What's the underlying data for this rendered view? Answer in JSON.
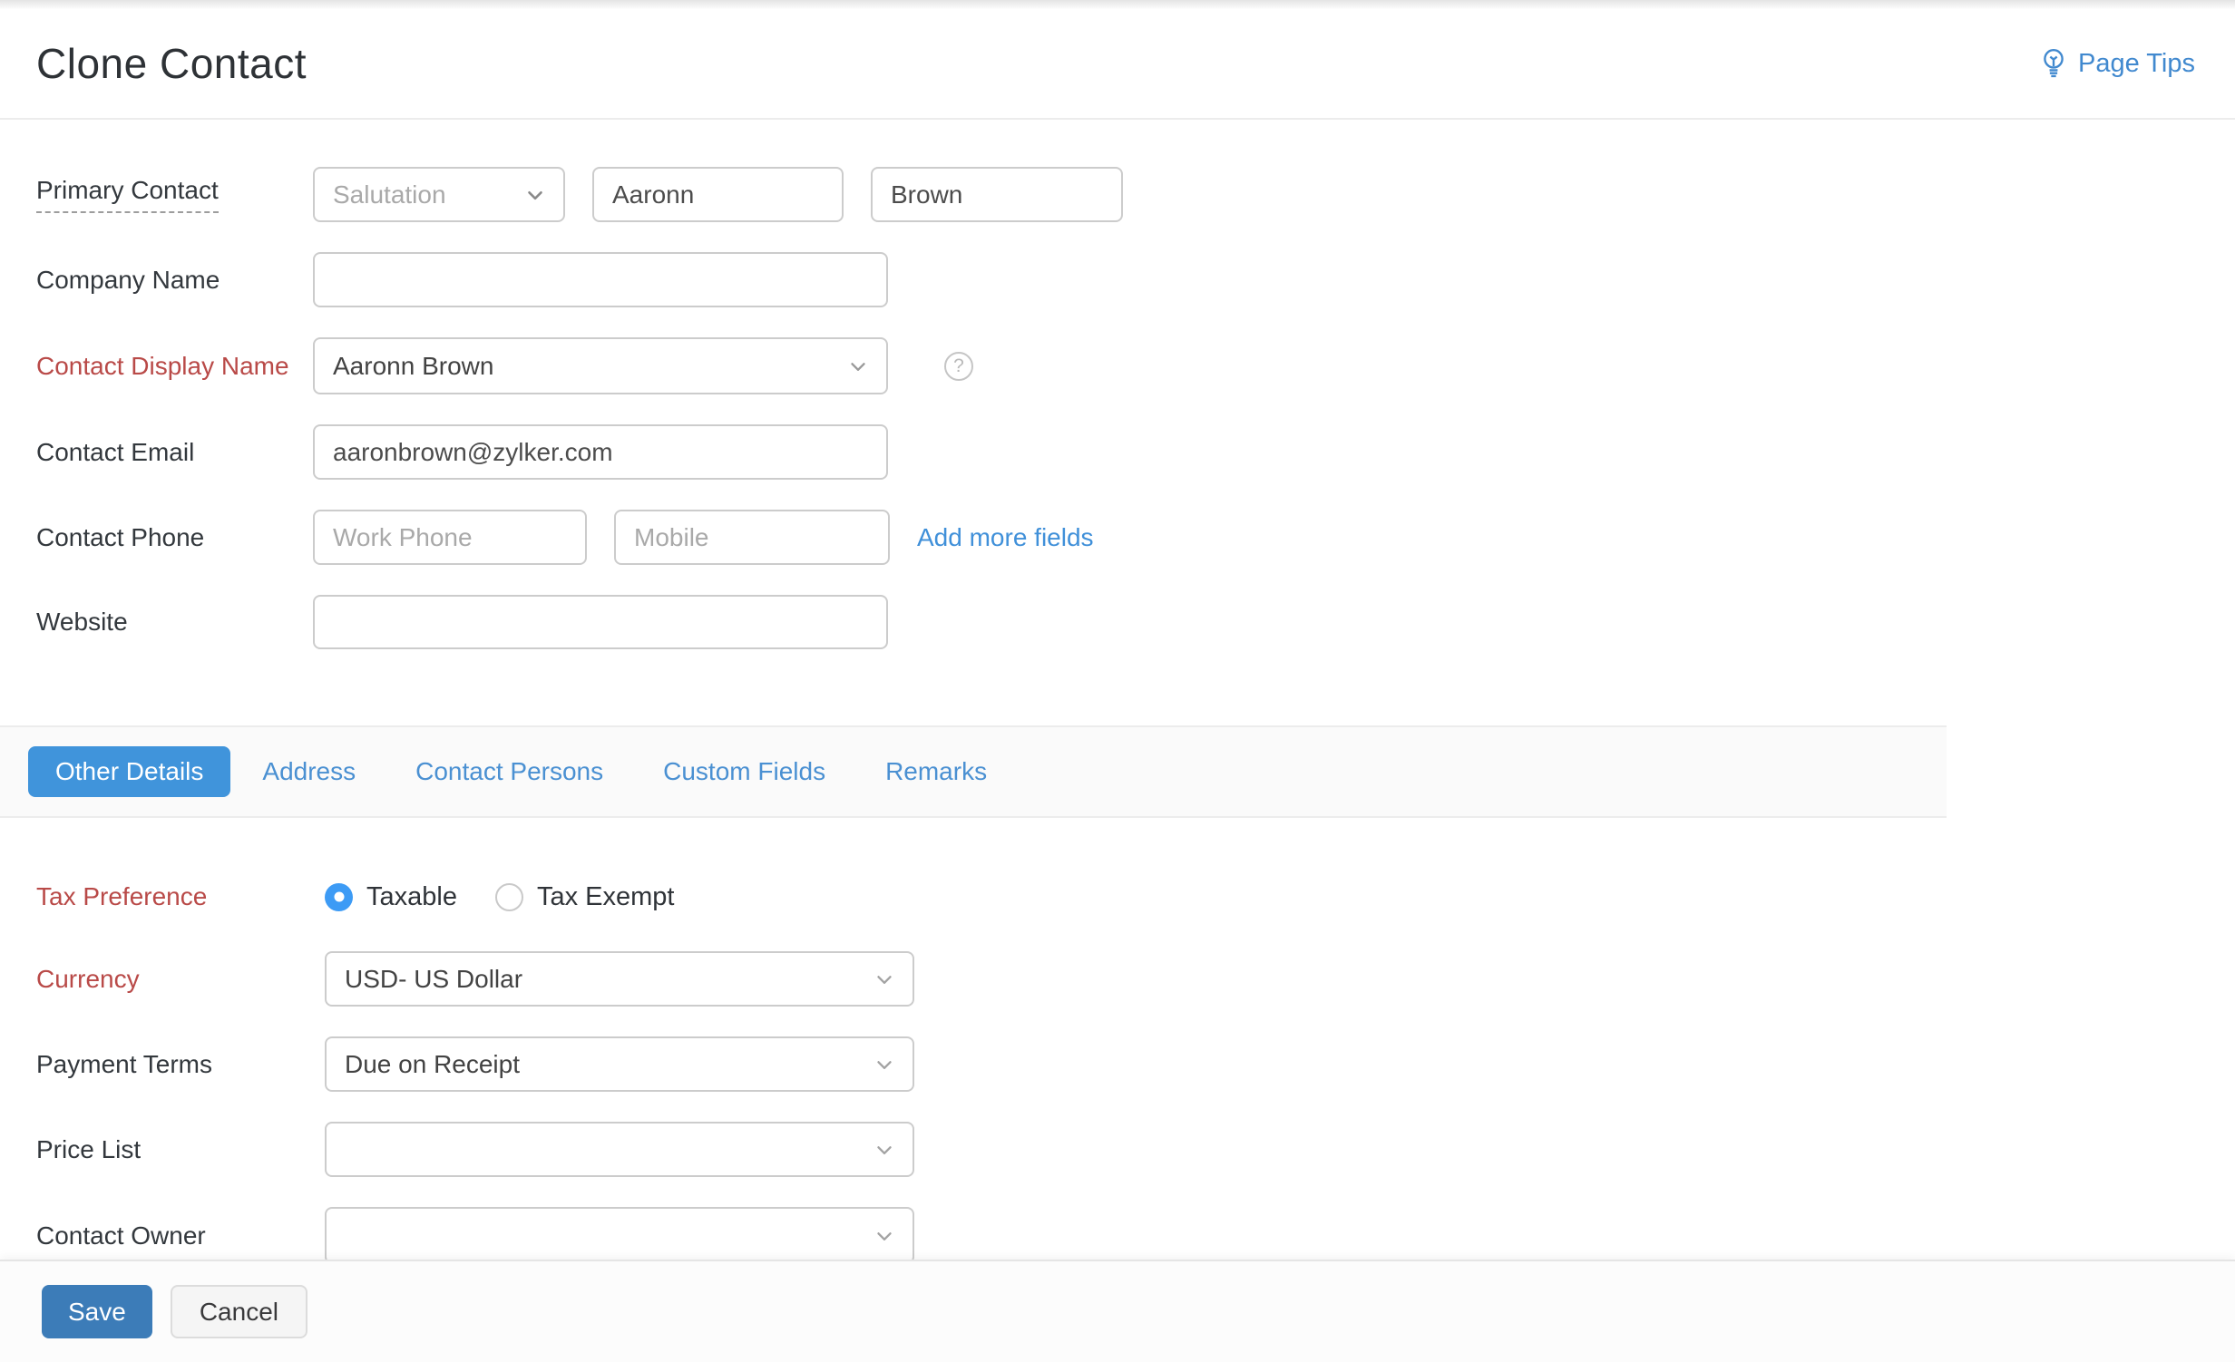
{
  "header": {
    "title": "Clone Contact",
    "page_tips_label": "Page Tips",
    "page_tips_icon": "lightbulb-icon"
  },
  "form": {
    "primary_contact": {
      "label": "Primary Contact",
      "salutation_placeholder": "Salutation",
      "first_name": "Aaronn",
      "last_name": "Brown"
    },
    "company_name": {
      "label": "Company Name",
      "value": ""
    },
    "contact_display_name": {
      "label": "Contact Display Name",
      "value": "Aaronn Brown",
      "help_icon": "question-circle-icon",
      "help_glyph": "?"
    },
    "contact_email": {
      "label": "Contact Email",
      "value": "aaronbrown@zylker.com"
    },
    "contact_phone": {
      "label": "Contact Phone",
      "work_phone_placeholder": "Work Phone",
      "mobile_placeholder": "Mobile",
      "add_more_fields_label": "Add more fields"
    },
    "website": {
      "label": "Website",
      "value": ""
    }
  },
  "tabs": {
    "items": [
      {
        "label": "Other Details",
        "active": true
      },
      {
        "label": "Address",
        "active": false
      },
      {
        "label": "Contact Persons",
        "active": false
      },
      {
        "label": "Custom Fields",
        "active": false
      },
      {
        "label": "Remarks",
        "active": false
      }
    ]
  },
  "other_details": {
    "tax_preference": {
      "label": "Tax Preference",
      "options": [
        {
          "label": "Taxable",
          "selected": true
        },
        {
          "label": "Tax Exempt",
          "selected": false
        }
      ]
    },
    "currency": {
      "label": "Currency",
      "value": "USD- US Dollar"
    },
    "payment_terms": {
      "label": "Payment Terms",
      "value": "Due on Receipt"
    },
    "price_list": {
      "label": "Price List",
      "value": ""
    },
    "contact_owner": {
      "label": "Contact Owner",
      "value": ""
    }
  },
  "footer": {
    "save_label": "Save",
    "cancel_label": "Cancel"
  },
  "colors": {
    "primary_button": "#3c7cb8",
    "active_tab": "#4094db",
    "link_blue": "#4090d9",
    "required_label_red": "#b94a48",
    "radio_selected_blue": "#3d9bf5",
    "input_border": "#cccccc",
    "tab_bar_background": "#fafafa"
  }
}
